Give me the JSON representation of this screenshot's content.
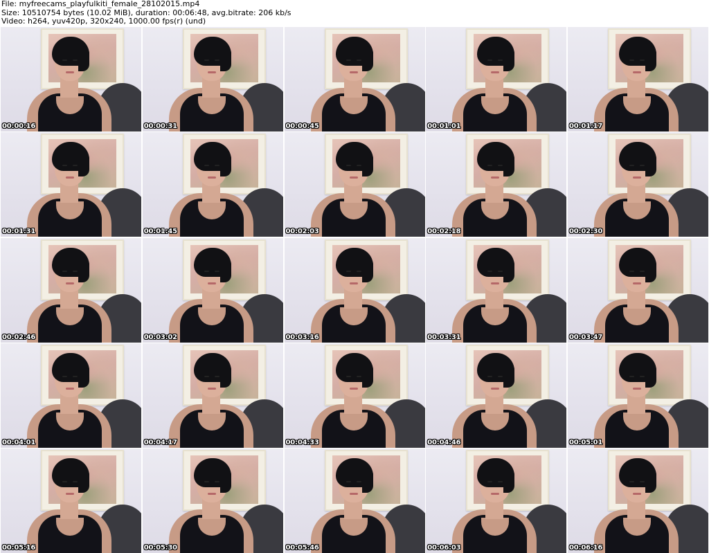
{
  "header": {
    "line1": "File: myfreecams_playfulkiti_female_28102015.mp4",
    "line2": "Size: 10510754 bytes (10.02 MiB), duration: 00:06:48, avg.bitrate: 206 kb/s",
    "line3": "Video: h264, yuv420p, 320x240, 1000.00 fps(r) (und)"
  },
  "thumbnails": [
    {
      "timestamp": "00:00:16"
    },
    {
      "timestamp": "00:00:31"
    },
    {
      "timestamp": "00:00:45"
    },
    {
      "timestamp": "00:01:01"
    },
    {
      "timestamp": "00:01:17"
    },
    {
      "timestamp": "00:01:31"
    },
    {
      "timestamp": "00:01:45"
    },
    {
      "timestamp": "00:02:03"
    },
    {
      "timestamp": "00:02:18"
    },
    {
      "timestamp": "00:02:30"
    },
    {
      "timestamp": "00:02:46"
    },
    {
      "timestamp": "00:03:02"
    },
    {
      "timestamp": "00:03:16"
    },
    {
      "timestamp": "00:03:31"
    },
    {
      "timestamp": "00:03:47"
    },
    {
      "timestamp": "00:04:01"
    },
    {
      "timestamp": "00:04:17"
    },
    {
      "timestamp": "00:04:33"
    },
    {
      "timestamp": "00:04:46"
    },
    {
      "timestamp": "00:05:01"
    },
    {
      "timestamp": "00:05:16"
    },
    {
      "timestamp": "00:05:30"
    },
    {
      "timestamp": "00:05:46"
    },
    {
      "timestamp": "00:06:03"
    },
    {
      "timestamp": "00:06:16"
    }
  ]
}
